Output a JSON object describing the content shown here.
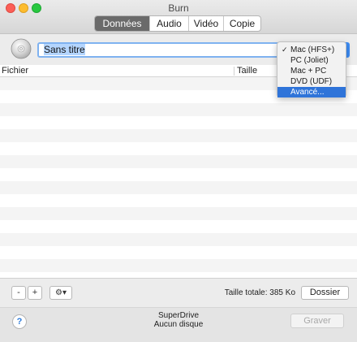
{
  "window": {
    "title": "Burn"
  },
  "tabs": [
    {
      "label": "Données",
      "active": true
    },
    {
      "label": "Audio",
      "active": false
    },
    {
      "label": "Vidéo",
      "active": false
    },
    {
      "label": "Copie",
      "active": false
    }
  ],
  "disc_name": {
    "value": "Sans titre"
  },
  "table": {
    "columns": [
      "Fichier",
      "Taille"
    ],
    "rows": []
  },
  "filesystem_menu": {
    "items": [
      {
        "label": "Mac (HFS+)",
        "checked": true,
        "highlighted": false
      },
      {
        "label": "PC (Joliet)",
        "checked": false,
        "highlighted": false
      },
      {
        "label": "Mac + PC",
        "checked": false,
        "highlighted": false
      },
      {
        "label": "DVD (UDF)",
        "checked": false,
        "highlighted": false
      },
      {
        "label": "Avancé...",
        "checked": false,
        "highlighted": true
      }
    ],
    "check_mark": "✓"
  },
  "bottom_bar": {
    "remove_label": "-",
    "add_label": "+",
    "gear_label": "⚙▾",
    "total_size": "Taille totale: 385 Ko",
    "folder_label": "Dossier"
  },
  "footer": {
    "help_label": "?",
    "drive_name": "SuperDrive",
    "drive_status": "Aucun disque",
    "burn_label": "Graver"
  },
  "colors": {
    "accent": "#3d8df6",
    "highlight": "#2f74d9",
    "tab_active": "#6a6a6a"
  },
  "icons": {
    "disc": "disc-icon",
    "gear": "gear-icon",
    "help": "help-icon"
  }
}
